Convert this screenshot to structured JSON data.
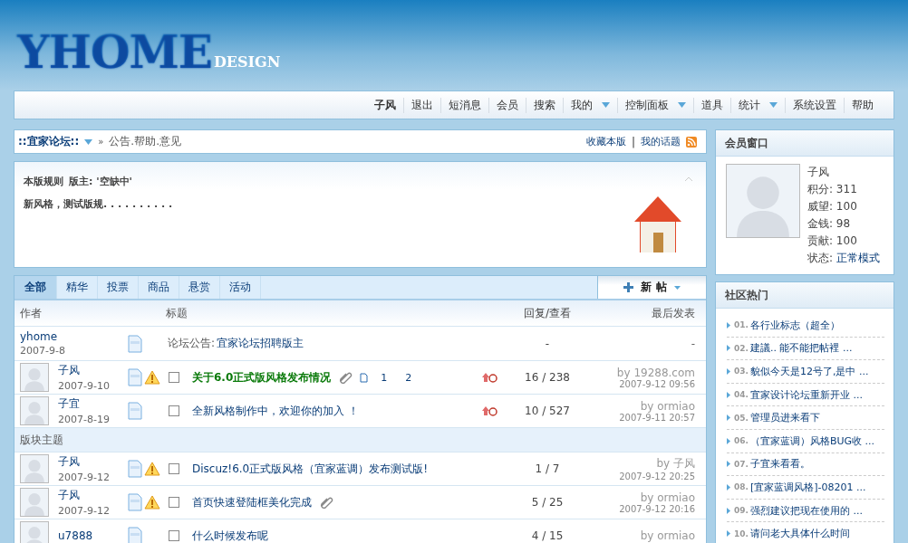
{
  "logo": {
    "text": "YHOME",
    "sub": "DESIGN"
  },
  "nav": {
    "user": "子风",
    "items": [
      {
        "label": "退出",
        "dropdown": false
      },
      {
        "label": "短消息",
        "dropdown": false
      },
      {
        "label": "会员",
        "dropdown": false
      },
      {
        "label": "搜索",
        "dropdown": false
      },
      {
        "label": "我的",
        "dropdown": true
      },
      {
        "label": "控制面板",
        "dropdown": true
      },
      {
        "label": "道具",
        "dropdown": false
      },
      {
        "label": "统计",
        "dropdown": true
      },
      {
        "label": "系统设置",
        "dropdown": false
      },
      {
        "label": "帮助",
        "dropdown": false
      }
    ]
  },
  "breadcrumb": {
    "forum": "::宜家论坛::",
    "separator": "»",
    "path": "公告.帮助.意见",
    "links": [
      "收藏本版",
      "我的话题"
    ],
    "link_separator": "|"
  },
  "rules": {
    "title": "本版规则",
    "moderator": "版主: '空缺中'",
    "body": "新风格，测试版规. . . . . . . . . ."
  },
  "tabs": [
    {
      "label": "全部",
      "selected": true
    },
    {
      "label": "精华",
      "selected": false
    },
    {
      "label": "投票",
      "selected": false
    },
    {
      "label": "商品",
      "selected": false
    },
    {
      "label": "悬赏",
      "selected": false
    },
    {
      "label": "活动",
      "selected": false
    }
  ],
  "new_post": "新 帖",
  "columns": [
    "作者",
    "标题",
    "回复/查看",
    "最后发表"
  ],
  "rows": [
    {
      "kind": "announcement",
      "author": "yhome",
      "date": "2007-9-8",
      "prefix": "论坛公告:",
      "title": "宜家论坛招聘版主",
      "replies": "-",
      "last": "-"
    },
    {
      "kind": "thread",
      "author": "子风",
      "date": "2007-9-10",
      "warning": true,
      "checked": false,
      "title": "关于6.0正式版风格发布情况",
      "highlight": true,
      "attachment": true,
      "pages": [
        "1",
        "2"
      ],
      "hot": true,
      "replies": "16 / 238",
      "last_by": "by 19288.com",
      "last_time": "2007-9-12 09:56"
    },
    {
      "kind": "thread",
      "author": "子宜",
      "date": "2007-8-19",
      "warning": false,
      "checked": false,
      "title": "全新风格制作中，欢迎你的加入 ！",
      "highlight": false,
      "attachment": false,
      "hot": true,
      "replies": "10 / 527",
      "last_by": "by ormiao",
      "last_time": "2007-9-11 20:57"
    },
    {
      "kind": "section",
      "section": "版块主题"
    },
    {
      "kind": "thread",
      "author": "子风",
      "date": "2007-9-12",
      "warning": true,
      "checked": false,
      "title": "Discuz!6.0正式版风格（宜家蓝调）发布测试版!",
      "highlight": false,
      "attachment": false,
      "hot": false,
      "replies": "1 / 7",
      "last_by": "by 子风",
      "last_time": "2007-9-12 20:25"
    },
    {
      "kind": "thread",
      "author": "子风",
      "date": "2007-9-12",
      "warning": true,
      "checked": false,
      "title": "首页快速登陆框美化完成",
      "highlight": false,
      "attachment": true,
      "hot": false,
      "replies": "5 / 25",
      "last_by": "by ormiao",
      "last_time": "2007-9-12 20:16"
    },
    {
      "kind": "thread",
      "author": "u7888",
      "warning": false,
      "checked": false,
      "title": "什么时候发布呢",
      "highlight": false,
      "attachment": false,
      "hot": false,
      "replies": "4 / 15",
      "last_by": "by ormiao"
    }
  ],
  "member": {
    "title": "会员窗口",
    "name": "子风",
    "stats": [
      "积分: 311",
      "威望: 100",
      "金钱: 98",
      "贡献: 100"
    ],
    "status_label": "状态:",
    "status": "正常模式"
  },
  "hot": {
    "title": "社区热门",
    "items": [
      {
        "num": "01.",
        "title": "各行业标志（超全）"
      },
      {
        "num": "02.",
        "title": "建議.. 能不能把帖裡 ..."
      },
      {
        "num": "03.",
        "title": "貌似今天是12号了,是中 ..."
      },
      {
        "num": "04.",
        "title": "宜家设计论坛重新开业 ..."
      },
      {
        "num": "05.",
        "title": "管理员进来看下"
      },
      {
        "num": "06.",
        "title": "（宜家蓝调）风格BUG收 ..."
      },
      {
        "num": "07.",
        "title": "子宜来看看。"
      },
      {
        "num": "08.",
        "title": "[宜家蓝调风格]-08201 ..."
      },
      {
        "num": "09.",
        "title": "强烈建议把现在使用的 ..."
      },
      {
        "num": "10.",
        "title": "请问老大具体什么时间"
      }
    ]
  }
}
